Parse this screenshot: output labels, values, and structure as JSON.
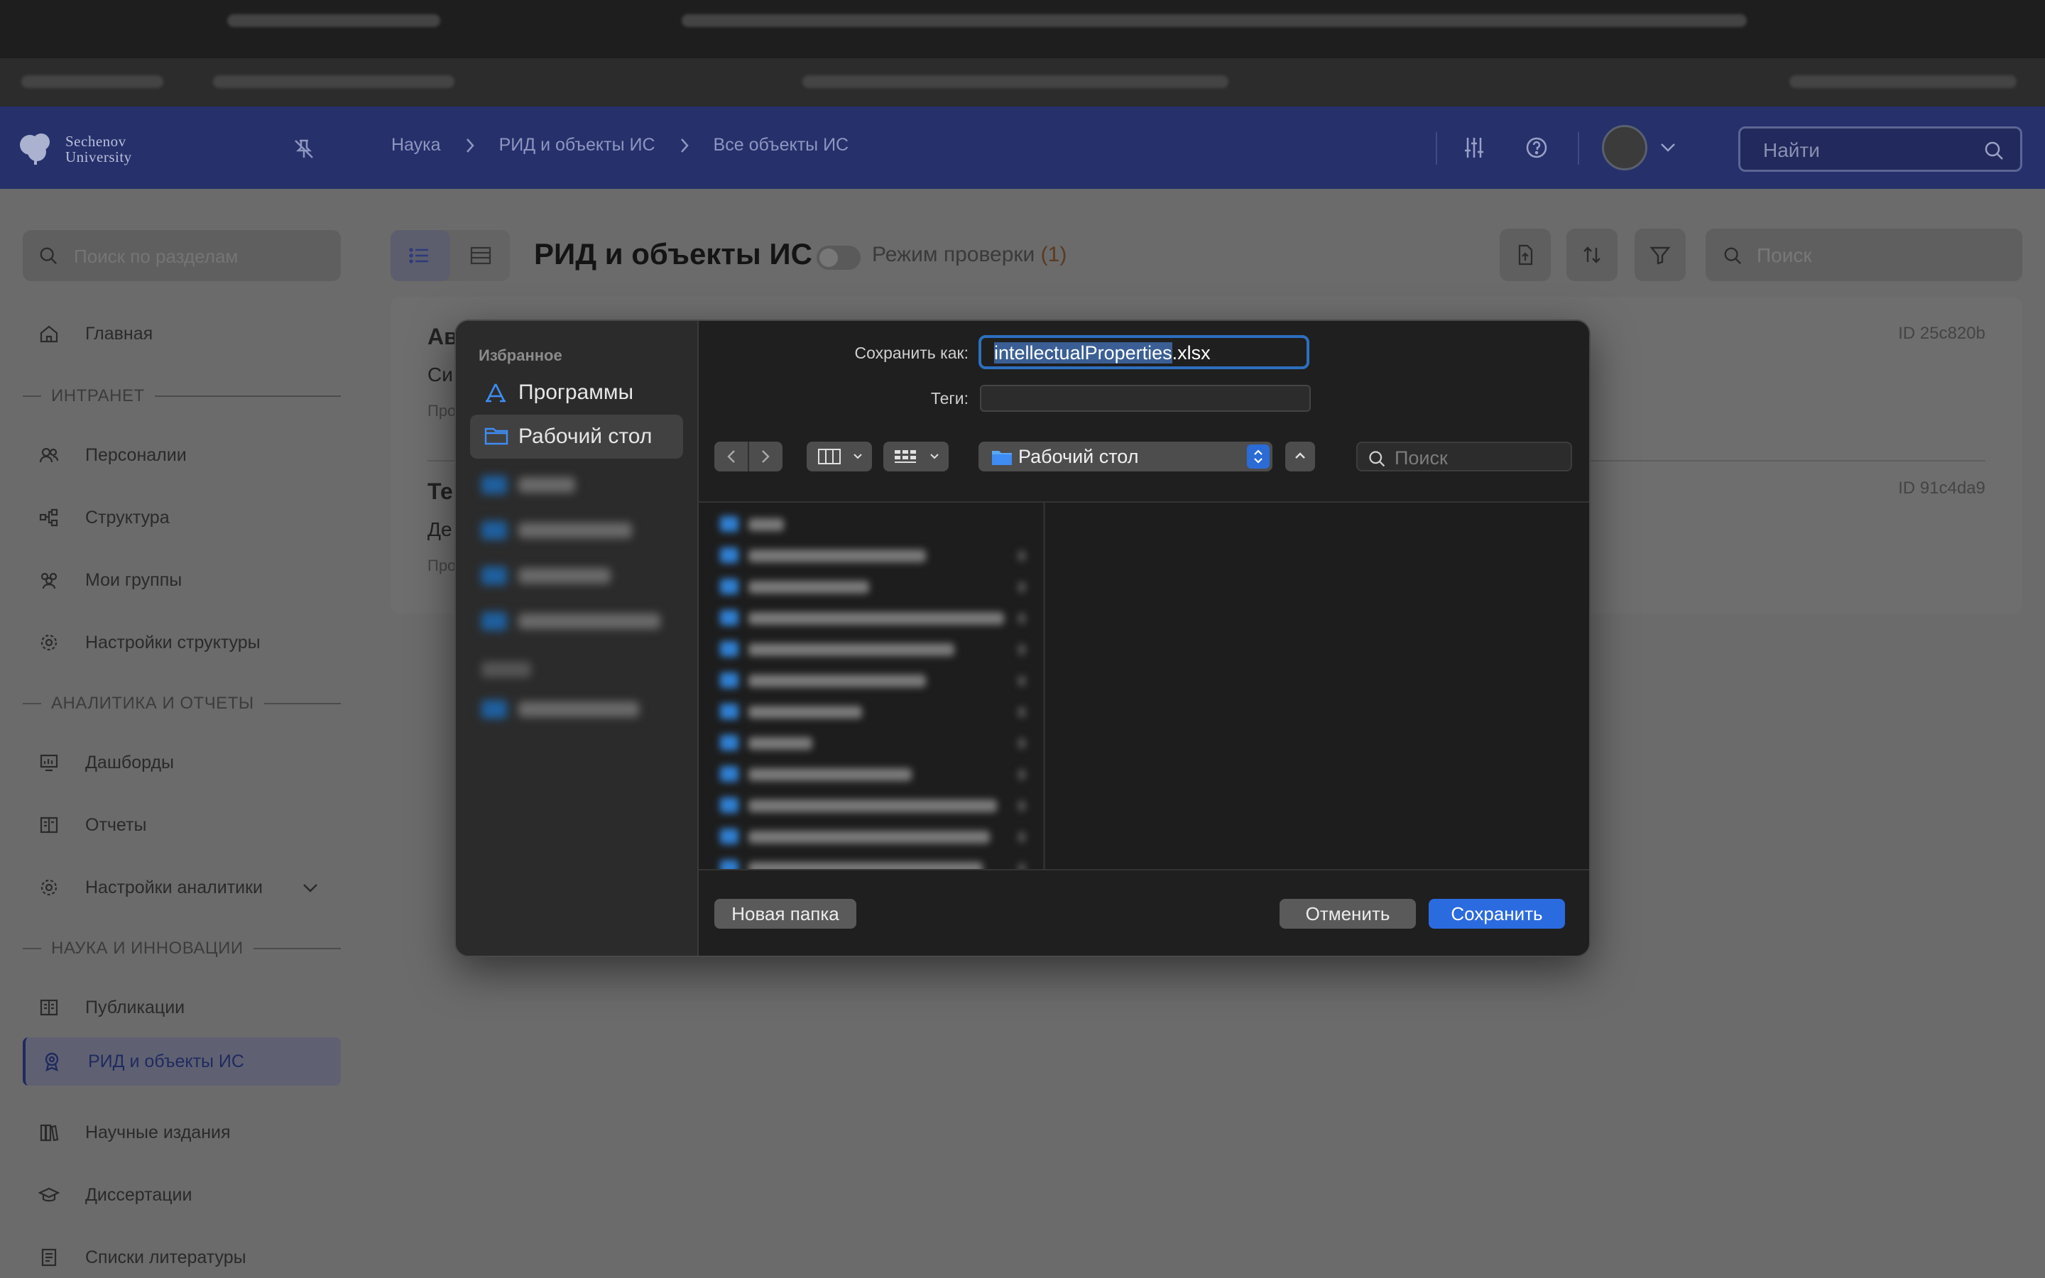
{
  "header": {
    "logo_line1": "Sechenov",
    "logo_line2": "University",
    "breadcrumb": [
      "Наука",
      "РИД и объекты ИС",
      "Все объекты ИС"
    ],
    "search_placeholder": "Найти"
  },
  "sidebar": {
    "search_placeholder": "Поиск по разделам",
    "items": [
      {
        "label": "Главная",
        "icon": "home-icon"
      },
      {
        "section": "ИНТРАНЕТ"
      },
      {
        "label": "Персоналии",
        "icon": "people-icon"
      },
      {
        "label": "Структура",
        "icon": "structure-icon"
      },
      {
        "label": "Мои группы",
        "icon": "groups-icon"
      },
      {
        "label": "Настройки структуры",
        "icon": "gear-icon"
      },
      {
        "section": "АНАЛИТИКА И ОТЧЕТЫ"
      },
      {
        "label": "Дашборды",
        "icon": "dashboard-icon"
      },
      {
        "label": "Отчеты",
        "icon": "report-icon"
      },
      {
        "label": "Настройки аналитики",
        "icon": "gear-icon"
      },
      {
        "section": "НАУКА И ИННОВАЦИИ"
      },
      {
        "label": "Публикации",
        "icon": "book-icon"
      },
      {
        "label": "РИД и объекты ИС",
        "icon": "award-icon",
        "active": true
      },
      {
        "label": "Научные издания",
        "icon": "journals-icon"
      },
      {
        "label": "Диссертации",
        "icon": "graduation-icon"
      },
      {
        "label": "Списки литературы",
        "icon": "list-book-icon"
      }
    ]
  },
  "main": {
    "title": "РИД и объекты ИС",
    "check_mode_label": "Режим проверки",
    "check_mode_count": "(1)",
    "search_placeholder": "Поиск",
    "cards": [
      {
        "title_fragment": "Ав",
        "line2": "Си",
        "line3": "Про",
        "id": "ID 25c820b"
      },
      {
        "title_fragment": "Те",
        "line2": "Де",
        "line3": "Про",
        "id": "ID 91c4da9"
      }
    ]
  },
  "dialog": {
    "favorites_header": "Избранное",
    "favorites": [
      "Программы",
      "Рабочий стол"
    ],
    "save_as_label": "Сохранить как:",
    "filename_selected": "intellectualProperties",
    "filename_ext": ".xlsx",
    "tags_label": "Теги:",
    "location": "Рабочий стол",
    "search_placeholder": "Поиск",
    "new_folder": "Новая папка",
    "cancel": "Отменить",
    "save": "Сохранить"
  },
  "colors": {
    "header_bg": "#26306b",
    "primary_button": "#2b6be0",
    "selection": "#3b5f94"
  }
}
